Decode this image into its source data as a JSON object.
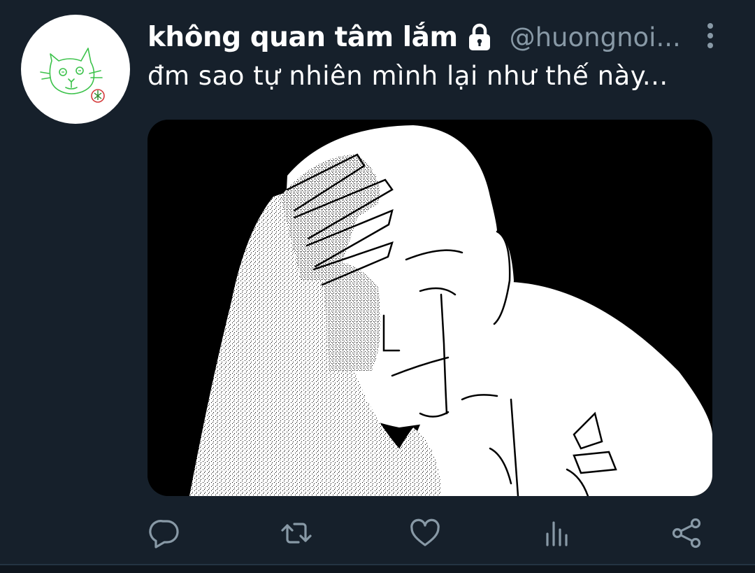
{
  "tweet": {
    "display_name": "không quan tâm lắm",
    "handle": "@huongnoi...",
    "text": "đm sao tự nhiên mình lại như thế này...",
    "protected_icon": "lock-icon",
    "more_icon": "vertical-ellipsis-icon",
    "media": {
      "kind": "image",
      "subject": "drawing-of-crying-man-with-hand-on-forehead"
    }
  },
  "actions": [
    {
      "name": "reply",
      "icon": "reply-icon"
    },
    {
      "name": "retweet",
      "icon": "retweet-icon"
    },
    {
      "name": "like",
      "icon": "heart-icon"
    },
    {
      "name": "analytics",
      "icon": "analytics-icon"
    },
    {
      "name": "share",
      "icon": "share-icon"
    }
  ],
  "colors": {
    "background": "#16202b",
    "text_primary": "#ffffff",
    "text_secondary": "#8899a6",
    "divider": "#243442"
  }
}
